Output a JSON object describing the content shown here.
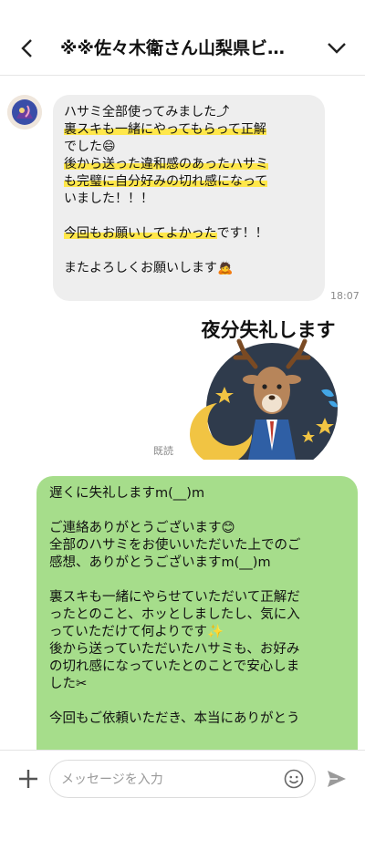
{
  "header": {
    "title": "※※佐々木衛さん山梨県ビ…"
  },
  "incoming": {
    "lines": [
      {
        "text": "ハサミ全部使ってみました⤴",
        "highlight": false
      },
      {
        "text": "裏スキも一緒にやってもらって正解",
        "highlight": true
      },
      {
        "text": "でした😄",
        "highlight": false
      },
      {
        "text": "後から送った違和感のあったハサミ",
        "highlight": true
      },
      {
        "text": "も完璧に自分好みの切れ感になって",
        "highlight": true
      },
      {
        "text": "いました！！！",
        "highlight": false
      },
      {
        "text": "",
        "highlight": false
      },
      {
        "text_hl": "今回もお願いしてよかった",
        "text_rest": "です！！"
      },
      {
        "text": "",
        "highlight": false
      },
      {
        "text": "またよろしくお願いします🙇",
        "highlight": false
      }
    ],
    "time": "18:07"
  },
  "sticker": {
    "caption": "夜分失礼します"
  },
  "status": {
    "read": "既読"
  },
  "outgoing": {
    "lines": [
      "遅くに失礼しますm(__)m",
      "",
      "ご連絡ありがとうございます😊",
      "全部のハサミをお使いいただいた上でのご",
      "感想、ありがとうございますm(__)m",
      "",
      "裏スキも一緒にやらせていただいて正解だ",
      "ったとのこと、ホッとしましたし、気に入",
      "っていただけて何よりです✨",
      "後から送っていただいたハサミも、お好み",
      "の切れ感になっていたとのことで安心しま",
      "した✂",
      "",
      "今回もご依頼いただき、本当にありがとう"
    ]
  },
  "composer": {
    "placeholder": "メッセージを入力"
  },
  "icons": {
    "back": "chevron-left-icon",
    "expand": "chevron-down-icon",
    "add": "plus-icon",
    "emoji": "smiley-icon",
    "send": "send-icon"
  },
  "colors": {
    "outgoing_bubble": "#a6dd8b",
    "incoming_bubble": "#eeeeee",
    "highlight": "#ffe74a"
  }
}
